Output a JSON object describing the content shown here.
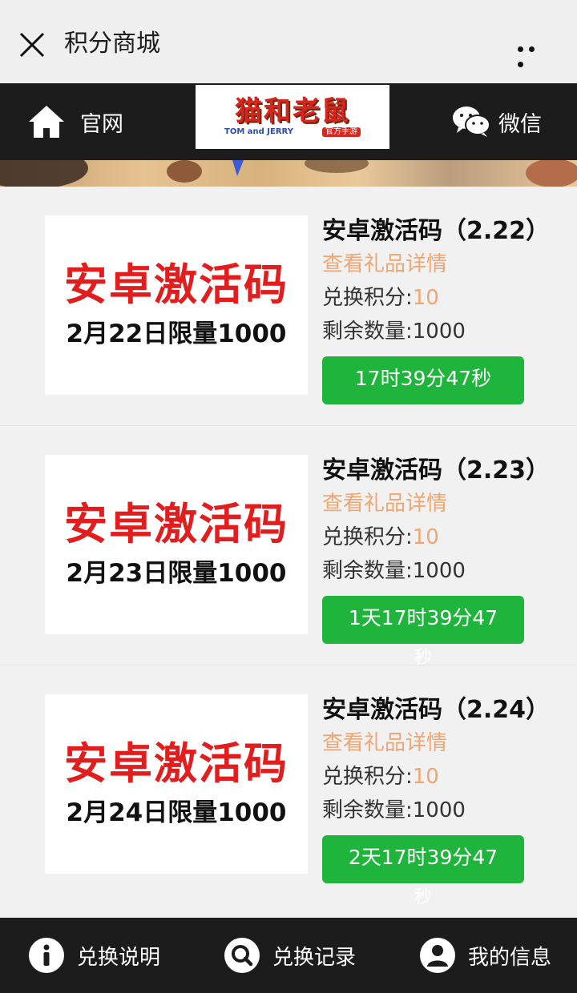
{
  "titlebar": {
    "title": "积分商城"
  },
  "header": {
    "home_label": "官网",
    "logo_text": "猫和老鼠",
    "logo_en": "TOM and JERRY",
    "logo_tag": "官方手游",
    "wechat_label": "微信"
  },
  "items": [
    {
      "name": "安卓激活码（2.22）",
      "detail_link": "查看礼品详情",
      "points_label": "兑换积分:",
      "points": "10",
      "stock_label": "剩余数量:",
      "stock": "1000",
      "countdown": "17时39分47秒",
      "countdown_overflow": "",
      "thumb_title": "安卓激活码",
      "thumb_sub": "2月22日限量1000"
    },
    {
      "name": "安卓激活码（2.23）",
      "detail_link": "查看礼品详情",
      "points_label": "兑换积分:",
      "points": "10",
      "stock_label": "剩余数量:",
      "stock": "1000",
      "countdown": "1天17时39分47",
      "countdown_overflow": "秒",
      "thumb_title": "安卓激活码",
      "thumb_sub": "2月23日限量1000"
    },
    {
      "name": "安卓激活码（2.24）",
      "detail_link": "查看礼品详情",
      "points_label": "兑换积分:",
      "points": "10",
      "stock_label": "剩余数量:",
      "stock": "1000",
      "countdown": "2天17时39分47",
      "countdown_overflow": "秒",
      "thumb_title": "安卓激活码",
      "thumb_sub": "2月24日限量1000"
    }
  ],
  "bottom_nav": {
    "rules_label": "兑换说明",
    "records_label": "兑换记录",
    "profile_label": "我的信息"
  },
  "colors": {
    "accent_green": "#1fb43b",
    "points_orange": "#f0a672",
    "thumb_red": "#e21d1d",
    "bar_dark": "#1c1c1c"
  }
}
